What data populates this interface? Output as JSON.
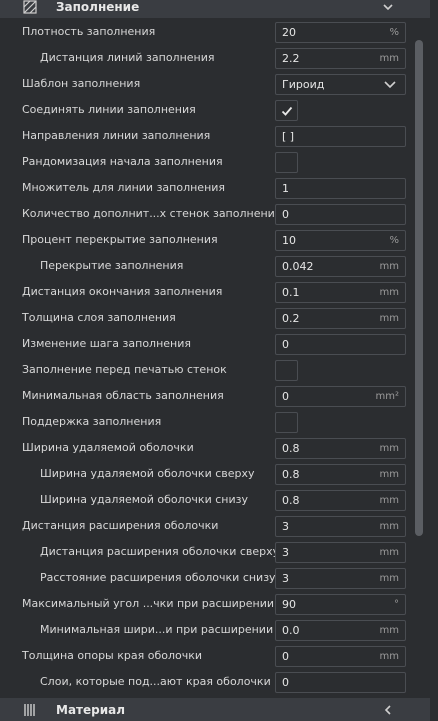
{
  "sections": {
    "infill": {
      "title": "Заполнение",
      "icon": "infill-pattern-icon"
    },
    "material": {
      "title": "Материал",
      "icon": "material-icon"
    }
  },
  "settings": [
    {
      "label": "Плотность заполнения",
      "value": "20",
      "unit": "%"
    },
    {
      "label": "Дистанция линий заполнения",
      "value": "2.2",
      "unit": "mm"
    },
    {
      "label": "Шаблон заполнения",
      "value": "Гироид",
      "type": "select"
    },
    {
      "label": "Соединять линии заполнения",
      "type": "checkbox",
      "checked": true
    },
    {
      "label": "Направления линии заполнения",
      "value": "[ ]",
      "unit": ""
    },
    {
      "label": "Рандомизация начала заполнения",
      "type": "checkbox",
      "checked": false
    },
    {
      "label": "Множитель для линии заполнения",
      "value": "1",
      "unit": ""
    },
    {
      "label": "Количество дополнит...х стенок заполнения",
      "value": "0",
      "unit": ""
    },
    {
      "label": "Процент перекрытие заполнения",
      "value": "10",
      "unit": "%"
    },
    {
      "label": "Перекрытие заполнения",
      "value": "0.042",
      "unit": "mm"
    },
    {
      "label": "Дистанция окончания заполнения",
      "value": "0.1",
      "unit": "mm"
    },
    {
      "label": "Толщина слоя заполнения",
      "value": "0.2",
      "unit": "mm"
    },
    {
      "label": "Изменение шага заполнения",
      "value": "0",
      "unit": ""
    },
    {
      "label": "Заполнение перед печатью стенок",
      "type": "checkbox",
      "checked": false
    },
    {
      "label": "Минимальная область заполнения",
      "value": "0",
      "unit": "mm²"
    },
    {
      "label": "Поддержка заполнения",
      "type": "checkbox",
      "checked": false
    },
    {
      "label": "Ширина удаляемой оболочки",
      "value": "0.8",
      "unit": "mm"
    },
    {
      "label": "Ширина удаляемой оболочки сверху",
      "value": "0.8",
      "unit": "mm"
    },
    {
      "label": "Ширина удаляемой оболочки снизу",
      "value": "0.8",
      "unit": "mm"
    },
    {
      "label": "Дистанция расширения оболочки",
      "value": "3",
      "unit": "mm"
    },
    {
      "label": "Дистанция расширения оболочки сверху",
      "value": "3",
      "unit": "mm"
    },
    {
      "label": "Расстояние расширения оболочки снизу",
      "value": "3",
      "unit": "mm"
    },
    {
      "label": "Максимальный угол ...чки при расширении",
      "value": "90",
      "unit": "°"
    },
    {
      "label": "Минимальная шири...и при расширении",
      "value": "0.0",
      "unit": "mm"
    },
    {
      "label": "Толщина опоры края оболочки",
      "value": "0",
      "unit": "mm"
    },
    {
      "label": "Слои, которые под...ают края оболочки",
      "value": "0",
      "unit": ""
    }
  ]
}
